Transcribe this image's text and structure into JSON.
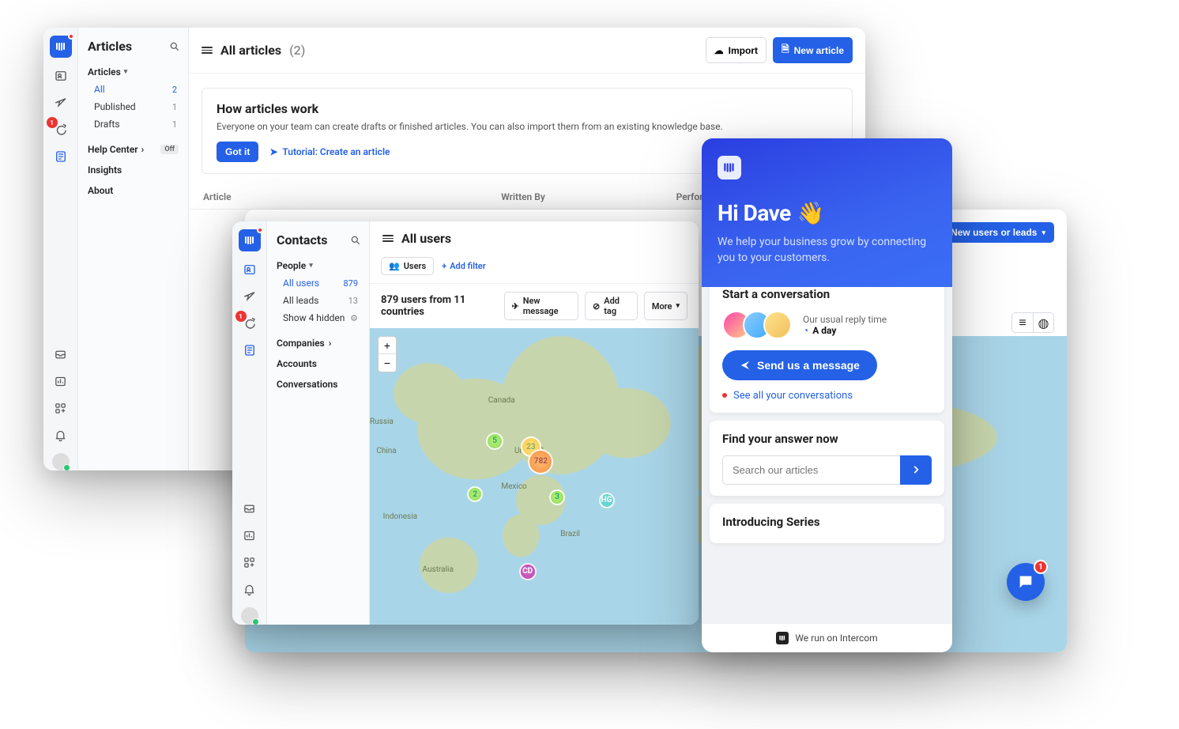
{
  "articles": {
    "side_title": "Articles",
    "group_label": "Articles",
    "items": [
      {
        "label": "All",
        "count": "2",
        "selected": true
      },
      {
        "label": "Published",
        "count": "1",
        "selected": false
      },
      {
        "label": "Drafts",
        "count": "1",
        "selected": false
      }
    ],
    "help_center_label": "Help Center",
    "help_center_status": "Off",
    "insights_label": "Insights",
    "about_label": "About",
    "page": {
      "title": "All articles",
      "count": "(2)",
      "import_btn": "Import",
      "new_btn": "New article",
      "info": {
        "heading": "How articles work",
        "body": "Everyone on your team can create drafts or finished articles. You can also import them from an existing knowledge base.",
        "got_it": "Got it",
        "tutorial": "Tutorial: Create an article"
      },
      "columns": {
        "c1": "Article",
        "c2": "Written By",
        "c3": "Performance"
      }
    }
  },
  "contacts": {
    "side_title": "Contacts",
    "group_label": "People",
    "items": [
      {
        "label": "All users",
        "count": "879",
        "selected": true
      },
      {
        "label": "All leads",
        "count": "13",
        "selected": false
      },
      {
        "label": "Show 4 hidden",
        "count": "",
        "selected": false,
        "gear": true
      }
    ],
    "companies_label": "Companies",
    "accounts_label": "Accounts",
    "conversations_label": "Conversations",
    "page": {
      "title": "All users",
      "chip_users": "Users",
      "add_filter": "Add filter",
      "summary": "879 users from 11 countries",
      "new_message": "New message",
      "add_tag": "Add tag",
      "more": "More",
      "zoom_in": "+",
      "zoom_out": "−",
      "map_labels": {
        "canada": "Canada",
        "united_states": "United S.",
        "mexico": "Mexico",
        "brazil": "Brazil",
        "russia": "Russia",
        "china": "China",
        "indonesia": "Indonesia",
        "australia": "Australia"
      },
      "markers": [
        {
          "val": "5",
          "cls": "m-g",
          "x": 38,
          "y": 38,
          "size": 22
        },
        {
          "val": "23",
          "cls": "m-y",
          "x": 49,
          "y": 40,
          "size": 26
        },
        {
          "val": "782",
          "cls": "m-o",
          "x": 52,
          "y": 45,
          "size": 32
        },
        {
          "val": "2",
          "cls": "m-g",
          "x": 32,
          "y": 56,
          "size": 20
        },
        {
          "val": "3",
          "cls": "m-g",
          "x": 57,
          "y": 57,
          "size": 20
        },
        {
          "val": "CD",
          "cls": "m-p",
          "x": 48,
          "y": 82,
          "size": 22
        },
        {
          "val": "HG",
          "cls": "m-c",
          "x": 72,
          "y": 58,
          "size": 20
        }
      ]
    }
  },
  "contacts_bg": {
    "new_button": "New users or leads"
  },
  "messenger": {
    "greeting": "Hi Dave",
    "wave": "👋",
    "sub": "We help your business grow by connecting you to your customers.",
    "start": {
      "title": "Start a conversation",
      "reply_label": "Our usual reply time",
      "reply_value": "A day",
      "send": "Send us a message",
      "see_all": "See all your conversations"
    },
    "find": {
      "title": "Find your answer now",
      "placeholder": "Search our articles"
    },
    "series": {
      "title": "Introducing Series"
    },
    "runon": "We run on Intercom",
    "bubble_badge": "1"
  }
}
